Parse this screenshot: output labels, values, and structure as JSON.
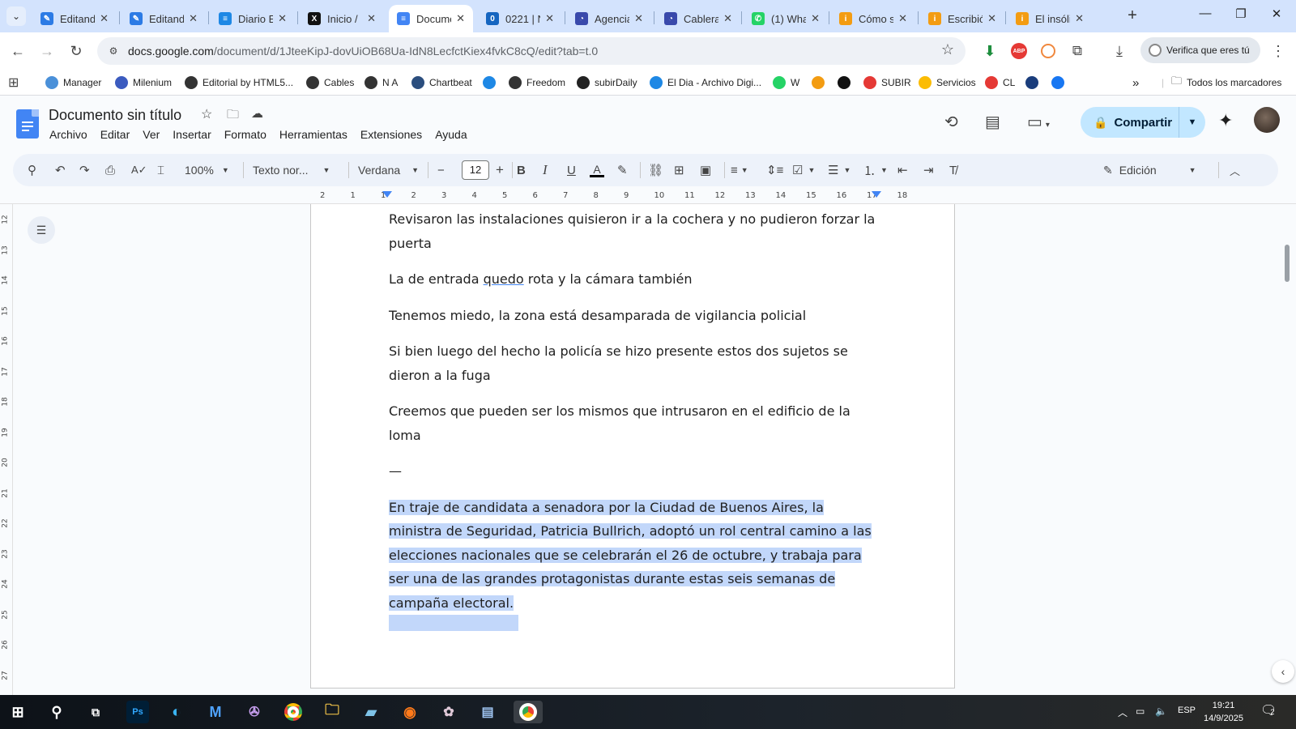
{
  "tabs": [
    {
      "label": "Editando",
      "icon": "editor-icon",
      "active": false
    },
    {
      "label": "Editando",
      "icon": "editor-icon",
      "active": false
    },
    {
      "label": "Diario El",
      "icon": "diario-icon",
      "active": false
    },
    {
      "label": "Inicio /",
      "icon": "x-icon",
      "active": false
    },
    {
      "label": "Documento",
      "icon": "docs-icon",
      "active": true
    },
    {
      "label": "0221 | N",
      "icon": "0221-icon",
      "active": false
    },
    {
      "label": "Agencia",
      "icon": "agencia-icon",
      "active": false
    },
    {
      "label": "Cablera",
      "icon": "cablera-icon",
      "active": false
    },
    {
      "label": "(1) WhatsApp",
      "icon": "whatsapp-icon",
      "active": false
    },
    {
      "label": "Cómo s",
      "icon": "info-icon",
      "active": false
    },
    {
      "label": "Escribió",
      "icon": "info-icon",
      "active": false
    },
    {
      "label": "El insólito",
      "icon": "info-icon",
      "active": false
    }
  ],
  "address": {
    "host": "docs.google.com",
    "path": "/document/d/1JteeKipJ-dovUiOB68Ua-IdN8LecfctKiex4fvkC8cQ/edit?tab=t.0"
  },
  "profile_pill": "Verifica que eres tú",
  "bookmarks": [
    {
      "label": "Manager",
      "color": "#4a90d9"
    },
    {
      "label": "Milenium",
      "color": "#3b5bbf"
    },
    {
      "label": "Editorial by HTML5...",
      "color": "#333333"
    },
    {
      "label": "Cables",
      "color": "#333333"
    },
    {
      "label": "N A",
      "color": "#333333"
    },
    {
      "label": "Chartbeat",
      "color": "#2b4e7e"
    },
    {
      "label": "",
      "color": "#1e88e5"
    },
    {
      "label": "Freedom",
      "color": "#333333"
    },
    {
      "label": "subirDaily",
      "color": "#222222"
    },
    {
      "label": "El Dia - Archivo Digi...",
      "color": "#1e88e5"
    },
    {
      "label": "W",
      "color": "#25d366"
    },
    {
      "label": "",
      "color": "#f39c12"
    },
    {
      "label": "",
      "color": "#111111"
    },
    {
      "label": "SUBIR",
      "color": "#e53935"
    },
    {
      "label": "Servicios",
      "color": "#fbbc04"
    },
    {
      "label": "CL",
      "color": "#e53935"
    },
    {
      "label": "",
      "color": "#1a3d7c"
    },
    {
      "label": "",
      "color": "#1877f2"
    }
  ],
  "bookmarks_overflow": "»",
  "all_bookmarks": "Todos los marcadores",
  "doc": {
    "title": "Documento sin título",
    "menu": [
      "Archivo",
      "Editar",
      "Ver",
      "Insertar",
      "Formato",
      "Herramientas",
      "Extensiones",
      "Ayuda"
    ],
    "share_label": "Compartir"
  },
  "format": {
    "zoom": "100%",
    "style": "Texto nor...",
    "font": "Verdana",
    "size": "12",
    "mode": "Edición"
  },
  "ruler": {
    "h_labels": [
      "2",
      "1",
      "1",
      "2",
      "3",
      "4",
      "5",
      "6",
      "7",
      "8",
      "9",
      "10",
      "11",
      "12",
      "13",
      "14",
      "15",
      "16",
      "17",
      "18"
    ],
    "v_labels": [
      "12",
      "13",
      "14",
      "15",
      "16",
      "17",
      "18",
      "19",
      "20",
      "21",
      "22",
      "23",
      "24",
      "25",
      "26",
      "27"
    ]
  },
  "paragraphs": [
    {
      "text": "Revisaron las instalaciones quisieron ir a la cochera y no pudieron forzar la puerta"
    },
    {
      "before": "La de entrada ",
      "spell": "quedo",
      "after": " rota y la cámara también"
    },
    {
      "text": "Tenemos miedo, la zona está desamparada de vigilancia policial"
    },
    {
      "text": "Si bien luego del hecho la policía se hizo presente estos dos sujetos se dieron a la fuga"
    },
    {
      "text": "Creemos que pueden ser los mismos que intrusaron en el edificio de la loma"
    },
    {
      "text": "—"
    }
  ],
  "selected_lines": [
    "En traje de candidata a senadora por la Ciudad de Buenos Aires, la",
    "ministra de Seguridad, Patricia Bullrich, adoptó un rol central camino a las",
    "elecciones nacionales que se celebrarán el 26 de octubre, y trabaja para",
    "ser una de las grandes protagonistas durante estas seis semanas de",
    "campaña electoral."
  ],
  "taskbar": {
    "lang": "ESP",
    "time": "19:21",
    "date": "14/9/2025",
    "notifications": "2"
  }
}
